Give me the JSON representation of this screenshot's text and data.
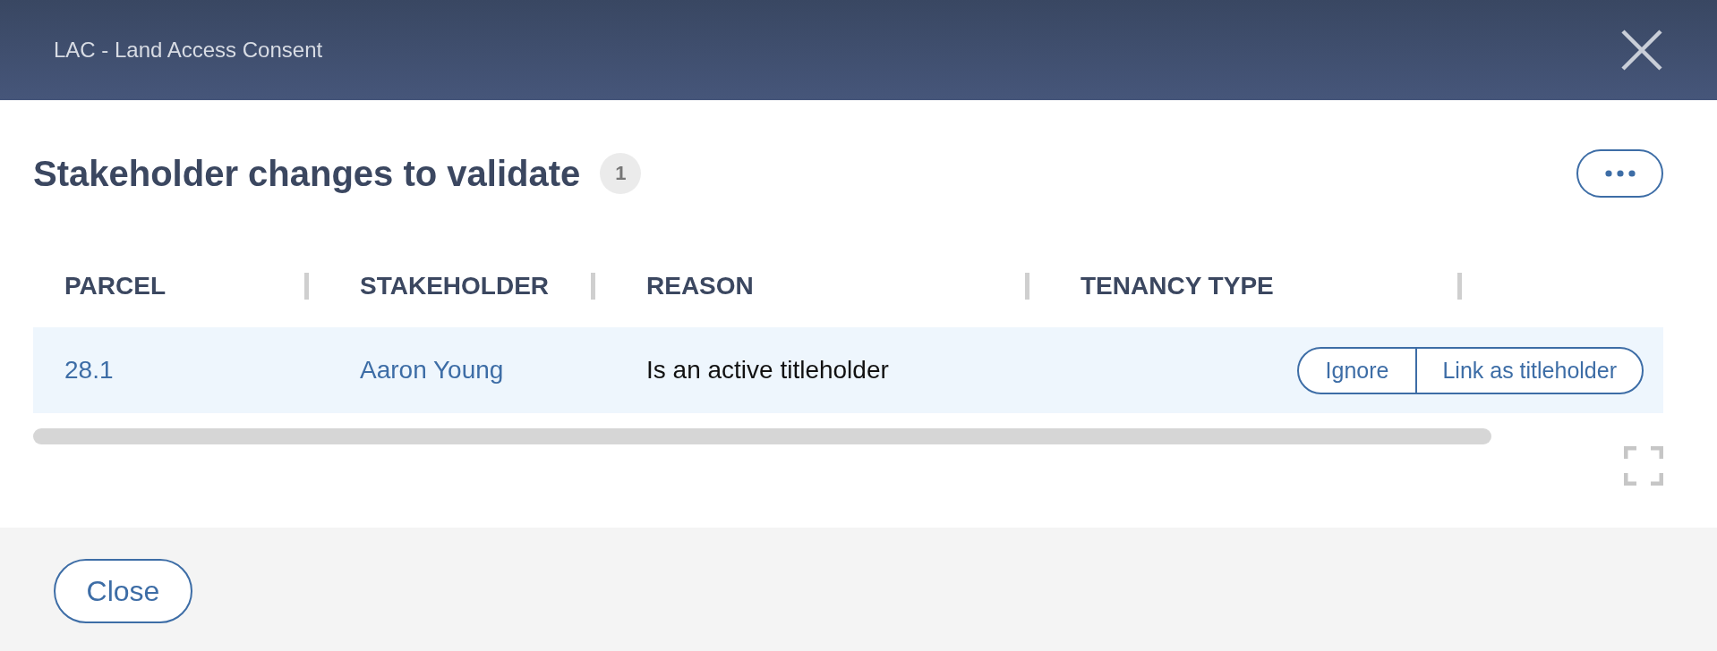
{
  "window": {
    "title": "LAC - Land Access Consent"
  },
  "heading": {
    "title": "Stakeholder changes to validate",
    "count": "1"
  },
  "table": {
    "columns": [
      "PARCEL",
      "STAKEHOLDER",
      "REASON",
      "TENANCY TYPE"
    ],
    "rows": [
      {
        "parcel": "28.1",
        "stakeholder": "Aaron Young",
        "reason": "Is an active titleholder",
        "tenancy_type": "",
        "actions": [
          "Ignore",
          "Link as titleholder"
        ]
      }
    ]
  },
  "footer": {
    "buttons": [
      "Close"
    ]
  }
}
